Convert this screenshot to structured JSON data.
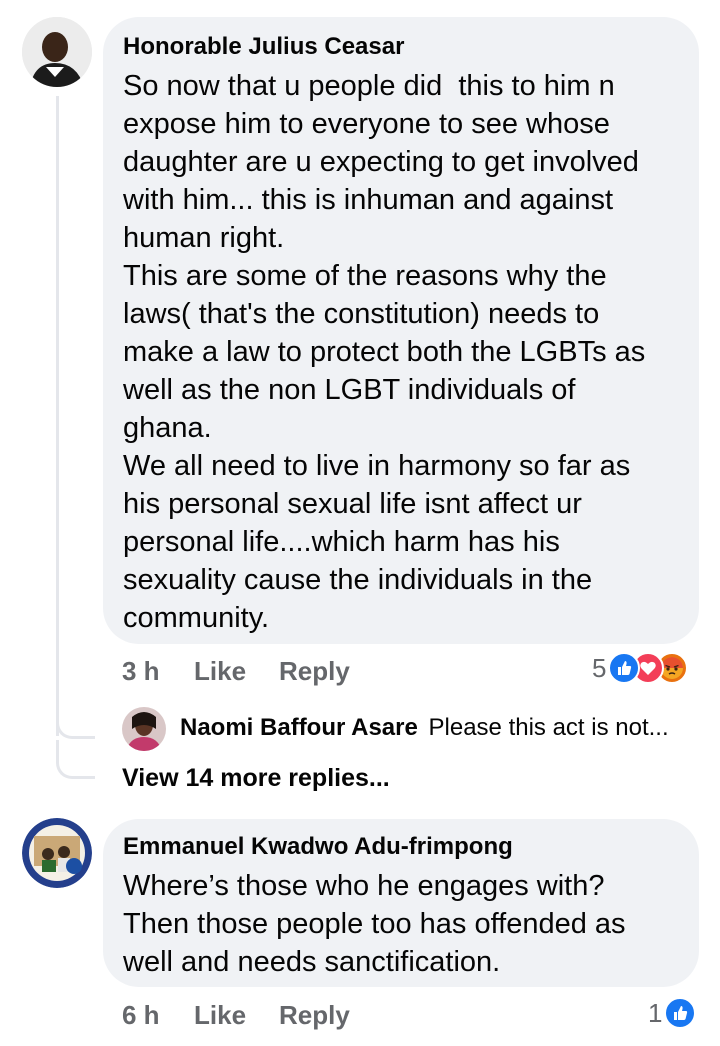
{
  "comments": [
    {
      "author": "Honorable Julius Ceasar",
      "text": "So now that u people did  this to him n\nexpose him to everyone to see whose\ndaughter are u expecting to get involved\nwith him... this is inhuman and against\nhuman right.\nThis are some of the reasons why the\nlaws( that's the constitution) needs to\nmake a law to protect both the LGBTs as\nwell as the non LGBT individuals of\nghana.\nWe all need to live in harmony so far as\nhis personal sexual life isnt affect ur\npersonal life....which harm has his\nsexuality cause the individuals in the\ncommunity.",
      "time": "3 h",
      "like": "Like",
      "reply": "Reply",
      "reaction_count": "5",
      "reaction_icons": [
        "like-icon",
        "love-icon",
        "angry-icon"
      ]
    },
    {
      "author": "Emmanuel Kwadwo Adu-frimpong",
      "text": "Where’s those who he engages with?\nThen those people too has offended as\nwell and needs sanctification.",
      "time": "6 h",
      "like": "Like",
      "reply": "Reply",
      "reaction_count": "1",
      "reaction_icons": [
        "like-icon"
      ]
    }
  ],
  "reply_preview": {
    "author": "Naomi Baffour Asare",
    "text": "Please this act is not..."
  },
  "view_more": "View 14 more replies...",
  "colors": {
    "bubble": "#f0f2f5",
    "meta": "#65676b",
    "like_blue": "#1877f2",
    "love_red": "#f33e58",
    "angry_orange": "#e9710f"
  }
}
